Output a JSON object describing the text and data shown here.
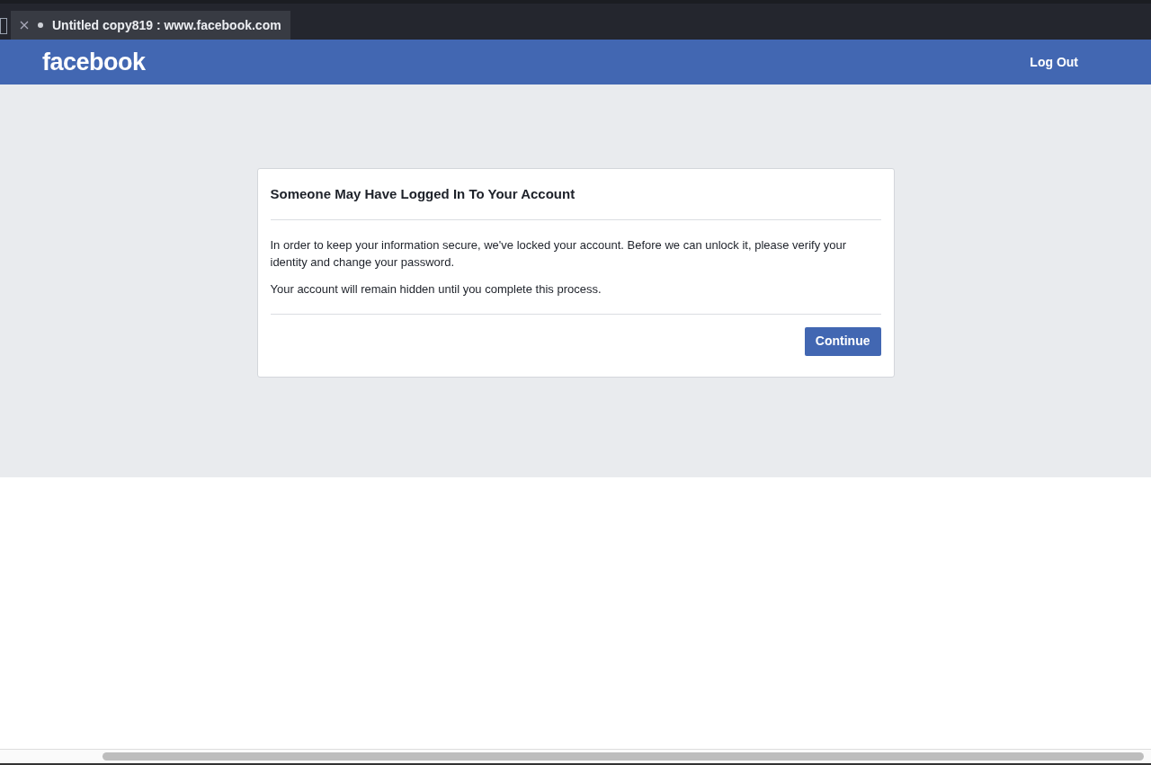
{
  "tab": {
    "title": "Untitled copy819 : www.facebook.com",
    "modified": true
  },
  "header": {
    "logo": "facebook",
    "logout": "Log Out"
  },
  "dialog": {
    "title": "Someone May Have Logged In To Your Account",
    "paragraphs": [
      "In order to keep your information secure, we've locked your account. Before we can unlock it, please verify your identity and change your password.",
      "Your account will remain hidden until you complete this process."
    ],
    "button": "Continue"
  }
}
